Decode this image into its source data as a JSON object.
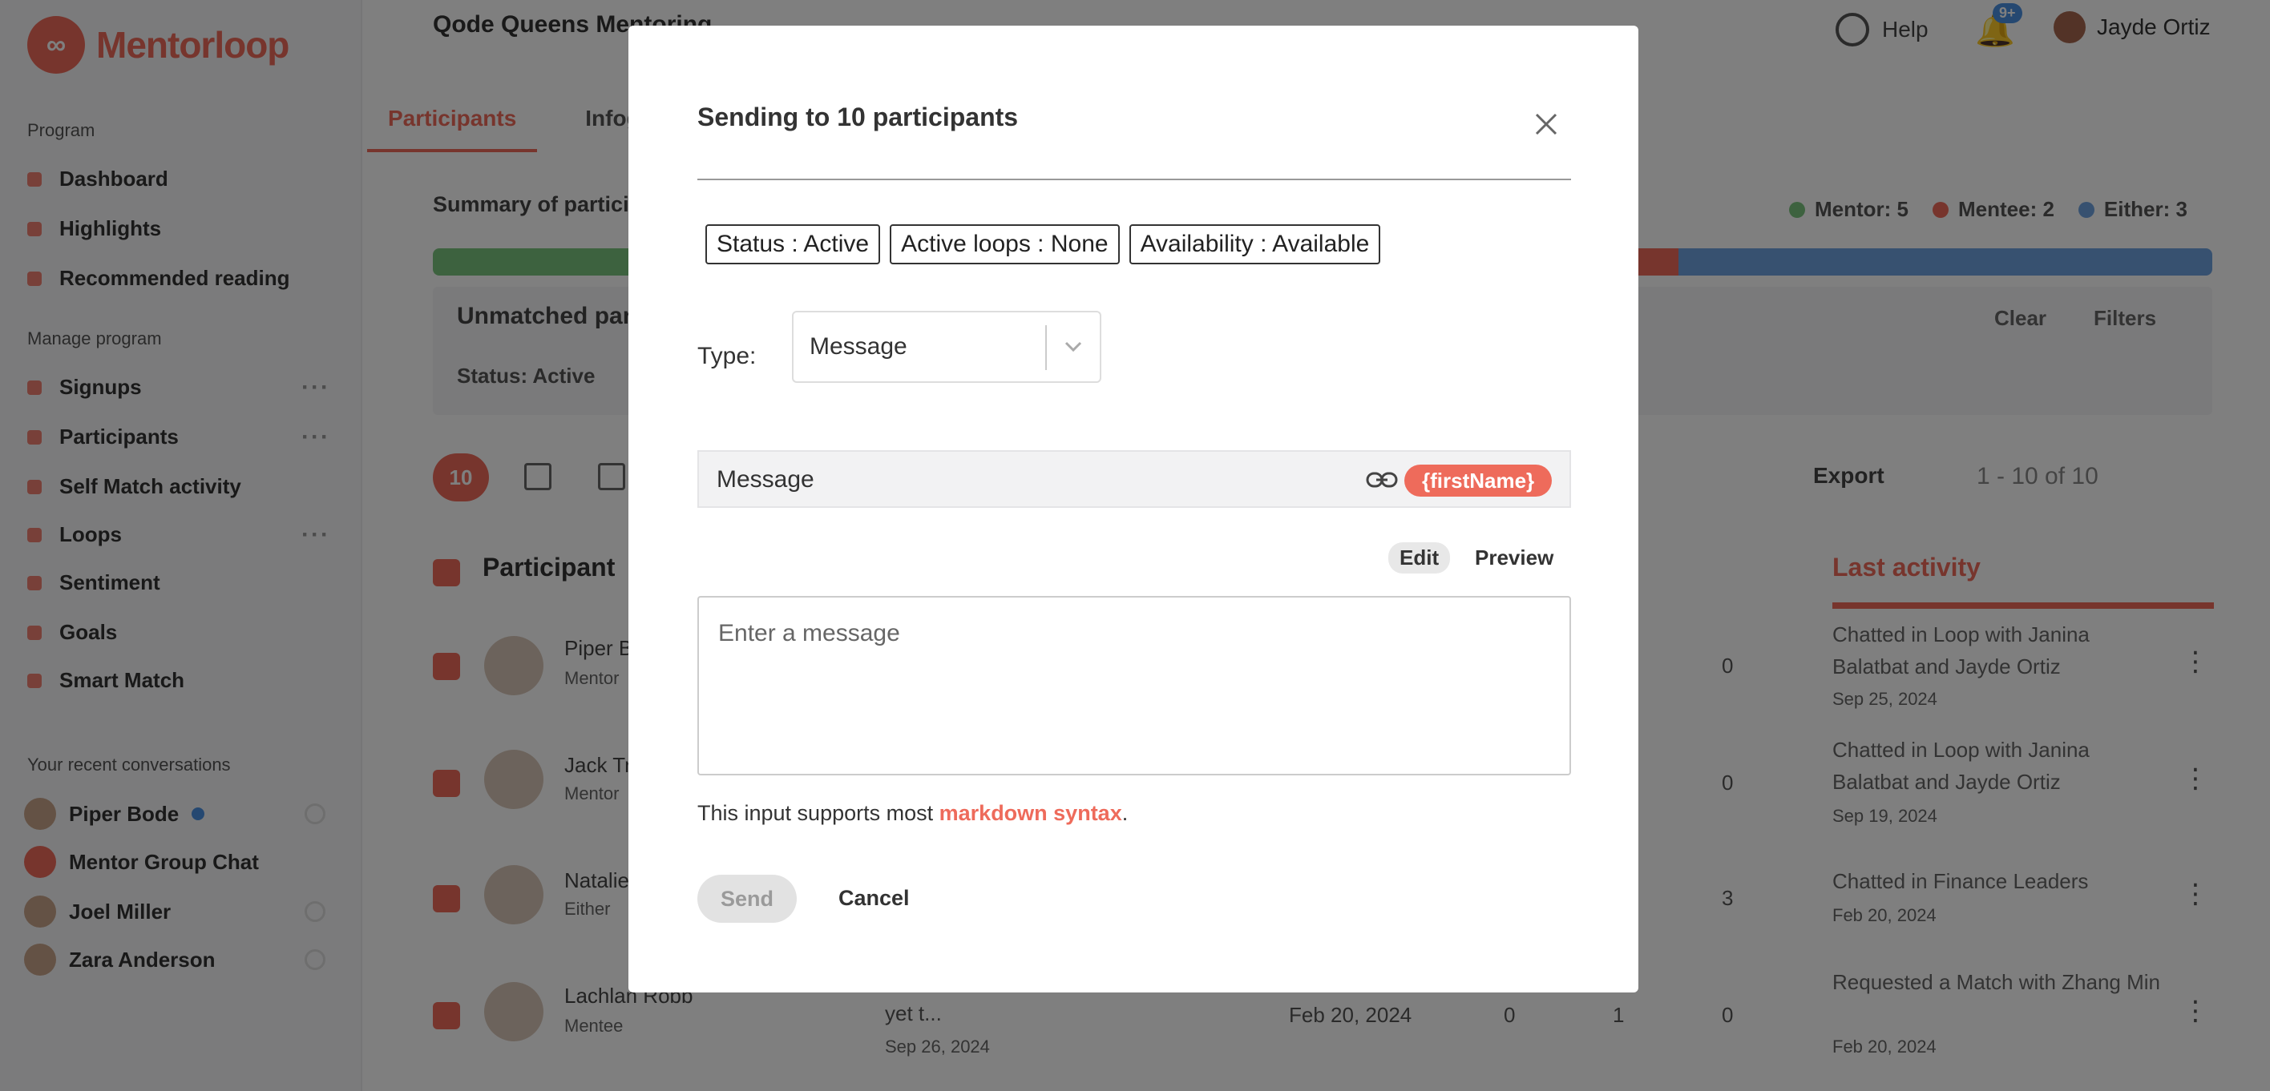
{
  "brand": {
    "name": "Mentorloop"
  },
  "header": {
    "program_name": "Qode Queens Mentoring",
    "help_label": "Help",
    "notif_badge": "9+",
    "user_name": "Jayde Ortiz"
  },
  "sidebar": {
    "section_program": "Program",
    "program_items": [
      {
        "label": "Dashboard"
      },
      {
        "label": "Highlights"
      },
      {
        "label": "Recommended reading"
      }
    ],
    "section_manage": "Manage program",
    "manage_items": [
      {
        "label": "Signups"
      },
      {
        "label": "Participants"
      },
      {
        "label": "Self Match activity"
      },
      {
        "label": "Loops"
      },
      {
        "label": "Sentiment"
      },
      {
        "label": "Goals"
      },
      {
        "label": "Smart Match"
      }
    ],
    "section_conversations": "Your recent conversations",
    "conversations": [
      {
        "label": "Piper Bode"
      },
      {
        "label": "Mentor Group Chat"
      },
      {
        "label": "Joel Miller"
      },
      {
        "label": "Zara Anderson"
      }
    ]
  },
  "main": {
    "tabs": [
      {
        "label": "Participants"
      },
      {
        "label": "Infogra"
      }
    ],
    "summary_label": "Summary of partici",
    "legend": [
      {
        "label": "Mentor: 5",
        "color": "#7bc47f"
      },
      {
        "label": "Mentee: 2",
        "color": "#ee6b5b"
      },
      {
        "label": "Either: 3",
        "color": "#6fa3e0"
      }
    ],
    "filter_title": "Unmatched par",
    "filter_chip": "Status: Active",
    "clear_label": "Clear",
    "filters_label": "Filters",
    "count_pill": "10",
    "export_label": "Export",
    "pager_label": "1 - 10 of 10",
    "col_participant": "Participant",
    "col_last_activity": "Last activity",
    "rows": [
      {
        "name": "Piper B",
        "role": "Mentor",
        "num": "0",
        "activity": "Chatted in Loop with Janina Balatbat and Jayde Ortiz",
        "date": "Sep 25, 2024"
      },
      {
        "name": "Jack Tr",
        "role": "Mentor",
        "num": "0",
        "activity": "Chatted in Loop with Janina Balatbat and Jayde Ortiz",
        "date": "Sep 19, 2024"
      },
      {
        "name": "Natalie",
        "role": "Either",
        "num": "3",
        "activity": "Chatted in Finance Leaders",
        "date": "Feb 20, 2024"
      },
      {
        "name": "Lachlan Robb",
        "role": "Mentee",
        "num": "0",
        "activity": "Requested a Match with Zhang Min",
        "date": "Feb 20, 2024"
      }
    ],
    "row4_extra": {
      "snippet": "yet t...",
      "snippet_date": "Sep 26, 2024",
      "joined": "Feb 20, 2024",
      "n1": "0",
      "n2": "1"
    }
  },
  "modal": {
    "title": "Sending to 10 participants",
    "tags": [
      {
        "label": "Status : Active"
      },
      {
        "label": "Active loops : None"
      },
      {
        "label": "Availability : Available"
      }
    ],
    "type_label": "Type:",
    "type_value": "Message",
    "message_label": "Message",
    "variable_pill": "{firstName}",
    "edit_tab": "Edit",
    "preview_tab": "Preview",
    "textarea_placeholder": "Enter a message",
    "markdown_note_prefix": "This input supports most ",
    "markdown_link": "markdown syntax",
    "markdown_note_suffix": ".",
    "send_label": "Send",
    "cancel_label": "Cancel"
  }
}
